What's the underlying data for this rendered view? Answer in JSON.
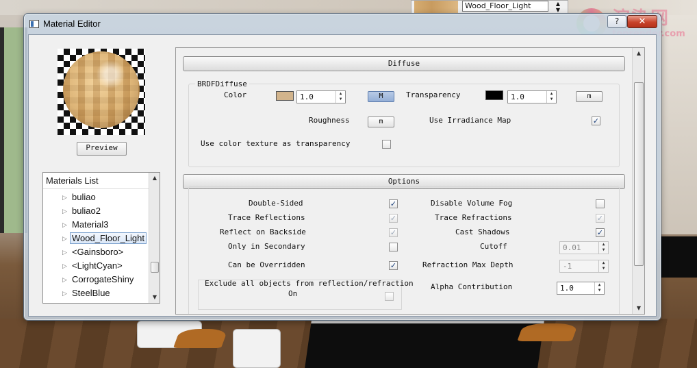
{
  "background": {
    "material_name": "Wood_Floor_Light",
    "watermark": {
      "cn": "渲染网",
      "en": "toprender.com"
    }
  },
  "window": {
    "title": "Material Editor",
    "help_label": "?",
    "close_label": "✕"
  },
  "preview": {
    "button_label": "Preview"
  },
  "materials_list": {
    "header": "Materials List",
    "items": [
      "buliao",
      "buliao2",
      "Material3",
      "Wood_Floor_Light",
      "<Gainsboro>",
      "<LightCyan>",
      "CorrogateShiny",
      "SteelBlue"
    ],
    "selected": "Wood_Floor_Light"
  },
  "diffuse": {
    "section_title": "Diffuse",
    "group_title": "BRDFDiffuse",
    "color_label": "Color",
    "color_value": "1.0",
    "color_swatch": "#d2b48c",
    "color_map_label": "M",
    "transparency_label": "Transparency",
    "transparency_value": "1.0",
    "transparency_swatch": "#000000",
    "transparency_map_label": "m",
    "roughness_label": "Roughness",
    "roughness_map_label": "m",
    "irradiance_label": "Use Irradiance Map",
    "irradiance_checked": true,
    "color_tex_label": "Use color texture as transparency",
    "color_tex_checked": false
  },
  "options": {
    "section_title": "Options",
    "double_sided": "Double-Sided",
    "trace_reflections": "Trace Reflections",
    "reflect_backside": "Reflect on Backside",
    "only_secondary": "Only in Secondary",
    "can_be_overridden": "Can be Overridden",
    "exclude_label": "Exclude all objects from reflection/refraction",
    "exclude_on": "On",
    "disable_volume_fog": "Disable Volume Fog",
    "trace_refractions": "Trace Refractions",
    "cast_shadows": "Cast Shadows",
    "cutoff": "Cutoff",
    "cutoff_value": "0.01",
    "refraction_max_depth": "Refraction Max Depth",
    "refraction_max_depth_value": "-1",
    "alpha_contribution": "Alpha Contribution",
    "alpha_contribution_value": "1.0"
  },
  "colors": {
    "close_button": "#c8432b",
    "selection": "#dbe8f8",
    "checkbox_mark": "#1a3f7a"
  }
}
